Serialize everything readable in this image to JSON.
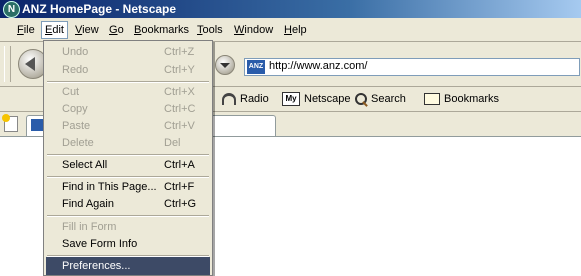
{
  "window": {
    "title": "ANZ HomePage - Netscape",
    "app_icon": "N"
  },
  "menubar": {
    "items": [
      {
        "label": "File",
        "u": "F"
      },
      {
        "label": "Edit",
        "u": "E"
      },
      {
        "label": "View",
        "u": "V"
      },
      {
        "label": "Go",
        "u": "G"
      },
      {
        "label": "Bookmarks",
        "u": "B"
      },
      {
        "label": "Tools",
        "u": "T"
      },
      {
        "label": "Window",
        "u": "W"
      },
      {
        "label": "Help",
        "u": "H"
      }
    ]
  },
  "navbar": {
    "url": "http://www.anz.com/",
    "site_icon_text": "ANZ"
  },
  "personal_toolbar": {
    "radio": "Radio",
    "netscape": "Netscape",
    "search": "Search",
    "bookmarks": "Bookmarks",
    "my_icon_text": "My"
  },
  "edit_menu": {
    "undo": {
      "label": "Undo",
      "shortcut": "Ctrl+Z",
      "enabled": false
    },
    "redo": {
      "label": "Redo",
      "shortcut": "Ctrl+Y",
      "enabled": false
    },
    "cut": {
      "label": "Cut",
      "shortcut": "Ctrl+X",
      "enabled": false
    },
    "copy": {
      "label": "Copy",
      "shortcut": "Ctrl+C",
      "enabled": false
    },
    "paste": {
      "label": "Paste",
      "shortcut": "Ctrl+V",
      "enabled": false
    },
    "delete": {
      "label": "Delete",
      "shortcut": "Del",
      "enabled": false
    },
    "select_all": {
      "label": "Select All",
      "shortcut": "Ctrl+A",
      "enabled": true
    },
    "find": {
      "label": "Find in This Page...",
      "shortcut": "Ctrl+F",
      "enabled": true
    },
    "find_again": {
      "label": "Find Again",
      "shortcut": "Ctrl+G",
      "enabled": true
    },
    "fill_form": {
      "label": "Fill in Form",
      "shortcut": "",
      "enabled": false
    },
    "save_form": {
      "label": "Save Form Info",
      "shortcut": "",
      "enabled": true
    },
    "preferences": {
      "label": "Preferences...",
      "shortcut": "",
      "enabled": true,
      "highlighted": true
    }
  },
  "colors": {
    "highlight": "#3d4a66",
    "menu_bg": "#ece9d8",
    "disabled_text": "#a19f93"
  }
}
